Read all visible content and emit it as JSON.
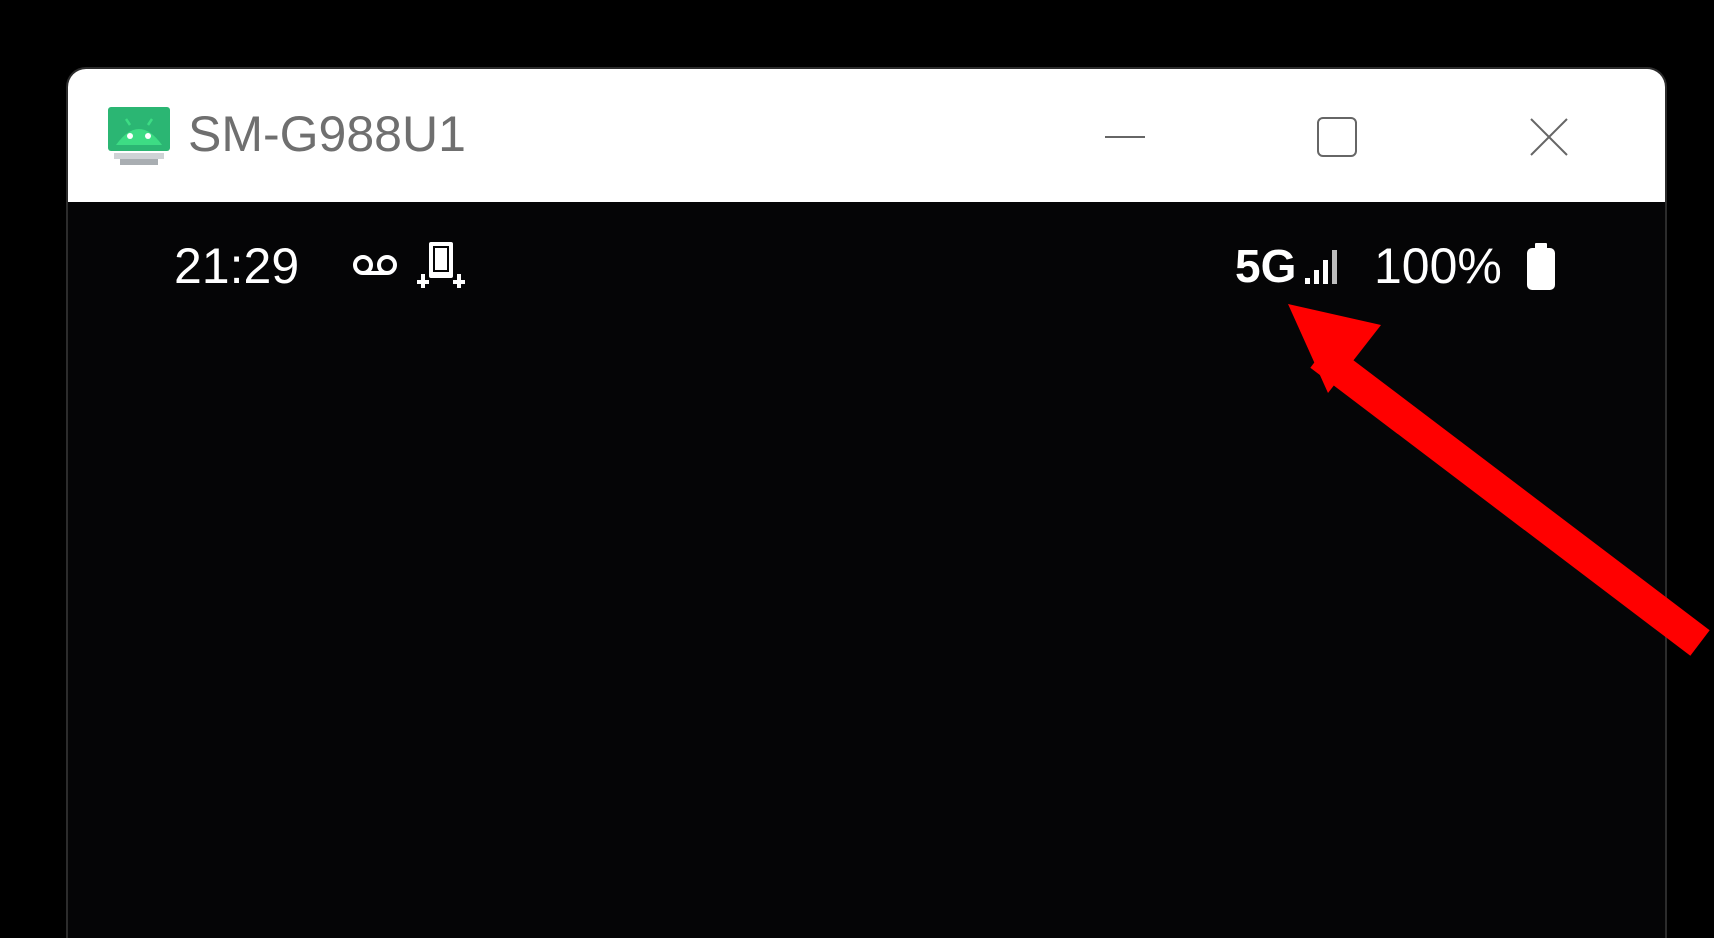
{
  "window": {
    "title": "SM-G988U1",
    "controls": {
      "minimize_icon": "minimize-icon",
      "maximize_icon": "maximize-icon",
      "close_icon": "close-icon"
    },
    "app_icon": "android-icon"
  },
  "status_bar": {
    "time": "21:29",
    "left_icons": [
      "voicemail-icon",
      "phone-mirror-icon"
    ],
    "network": "5G",
    "signal_icon": "signal-bars-icon",
    "battery_percent": "100%",
    "battery_icon": "battery-full-icon"
  },
  "annotation": {
    "arrow_color": "#ff0000",
    "points_to": "network"
  },
  "colors": {
    "titlebar_bg": "#ffffff",
    "screen_bg": "#050506",
    "android_green": "#3ddc84",
    "arrow_red": "#ff0000"
  }
}
